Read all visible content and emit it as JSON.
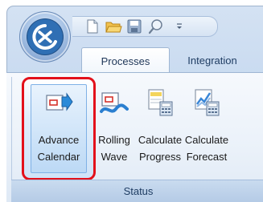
{
  "tabs": [
    {
      "label": "Processes"
    },
    {
      "label": "Integration"
    }
  ],
  "ribbon": {
    "buttons": [
      {
        "line1": "Advance",
        "line2": "Calendar",
        "icon": "advance-calendar-icon"
      },
      {
        "line1": "Rolling",
        "line2": "Wave",
        "icon": "rolling-wave-icon"
      },
      {
        "line1": "Calculate",
        "line2": "Progress",
        "icon": "calculate-progress-icon"
      },
      {
        "line1": "Calculate",
        "line2": "Forecast",
        "icon": "calculate-forecast-icon"
      }
    ],
    "group_label": "Status"
  },
  "qat": {
    "icons": [
      "new-document-icon",
      "open-folder-icon",
      "save-icon",
      "search-icon",
      "customize-dropdown-icon"
    ]
  },
  "colors": {
    "highlight_border": "#e3111b",
    "tab_text": "#1f3d63",
    "ribbon_background": "#eaf1f9"
  }
}
